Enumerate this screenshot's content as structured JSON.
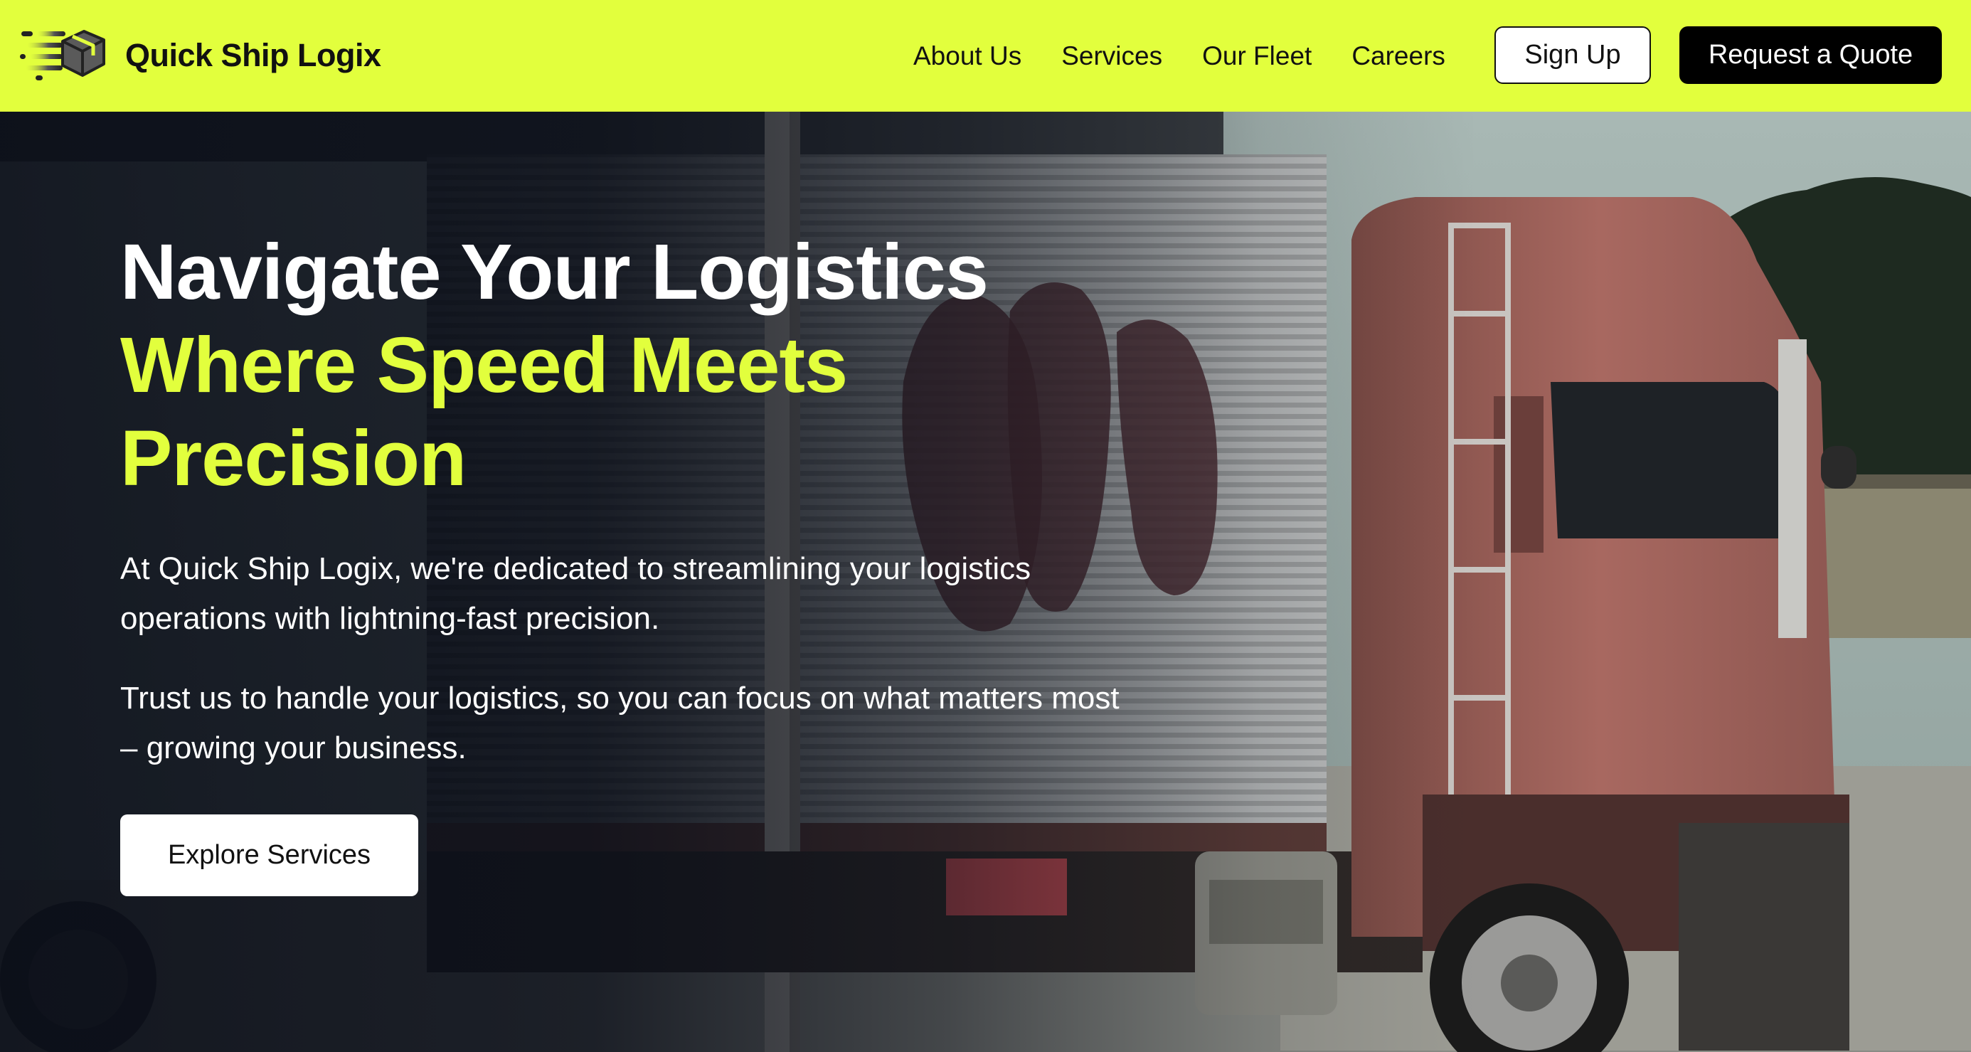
{
  "brand": {
    "name": "Quick Ship Logix",
    "logo_icon": "speeding-box-icon"
  },
  "colors": {
    "accent": "#e2ff3d",
    "header_bg": "#e2ff3d",
    "primary_button_bg": "#000000",
    "secondary_button_bg": "#ffffff",
    "hero_overlay": "#0a0e18"
  },
  "nav": {
    "items": [
      {
        "label": "About Us"
      },
      {
        "label": "Services"
      },
      {
        "label": "Our Fleet"
      },
      {
        "label": "Careers"
      }
    ],
    "signup_label": "Sign Up",
    "quote_label": "Request a Quote"
  },
  "hero": {
    "headline_line1": "Navigate Your Logistics",
    "headline_line2": "Where Speed Meets",
    "headline_line3": "Precision",
    "paragraph1": "At Quick Ship Logix, we're dedicated to streamlining your logistics operations with lightning-fast precision.",
    "paragraph2": "Trust us to handle your logistics, so you can focus on what matters most – growing your business.",
    "cta_label": "Explore Services",
    "background_image": "red-truck-photo"
  }
}
